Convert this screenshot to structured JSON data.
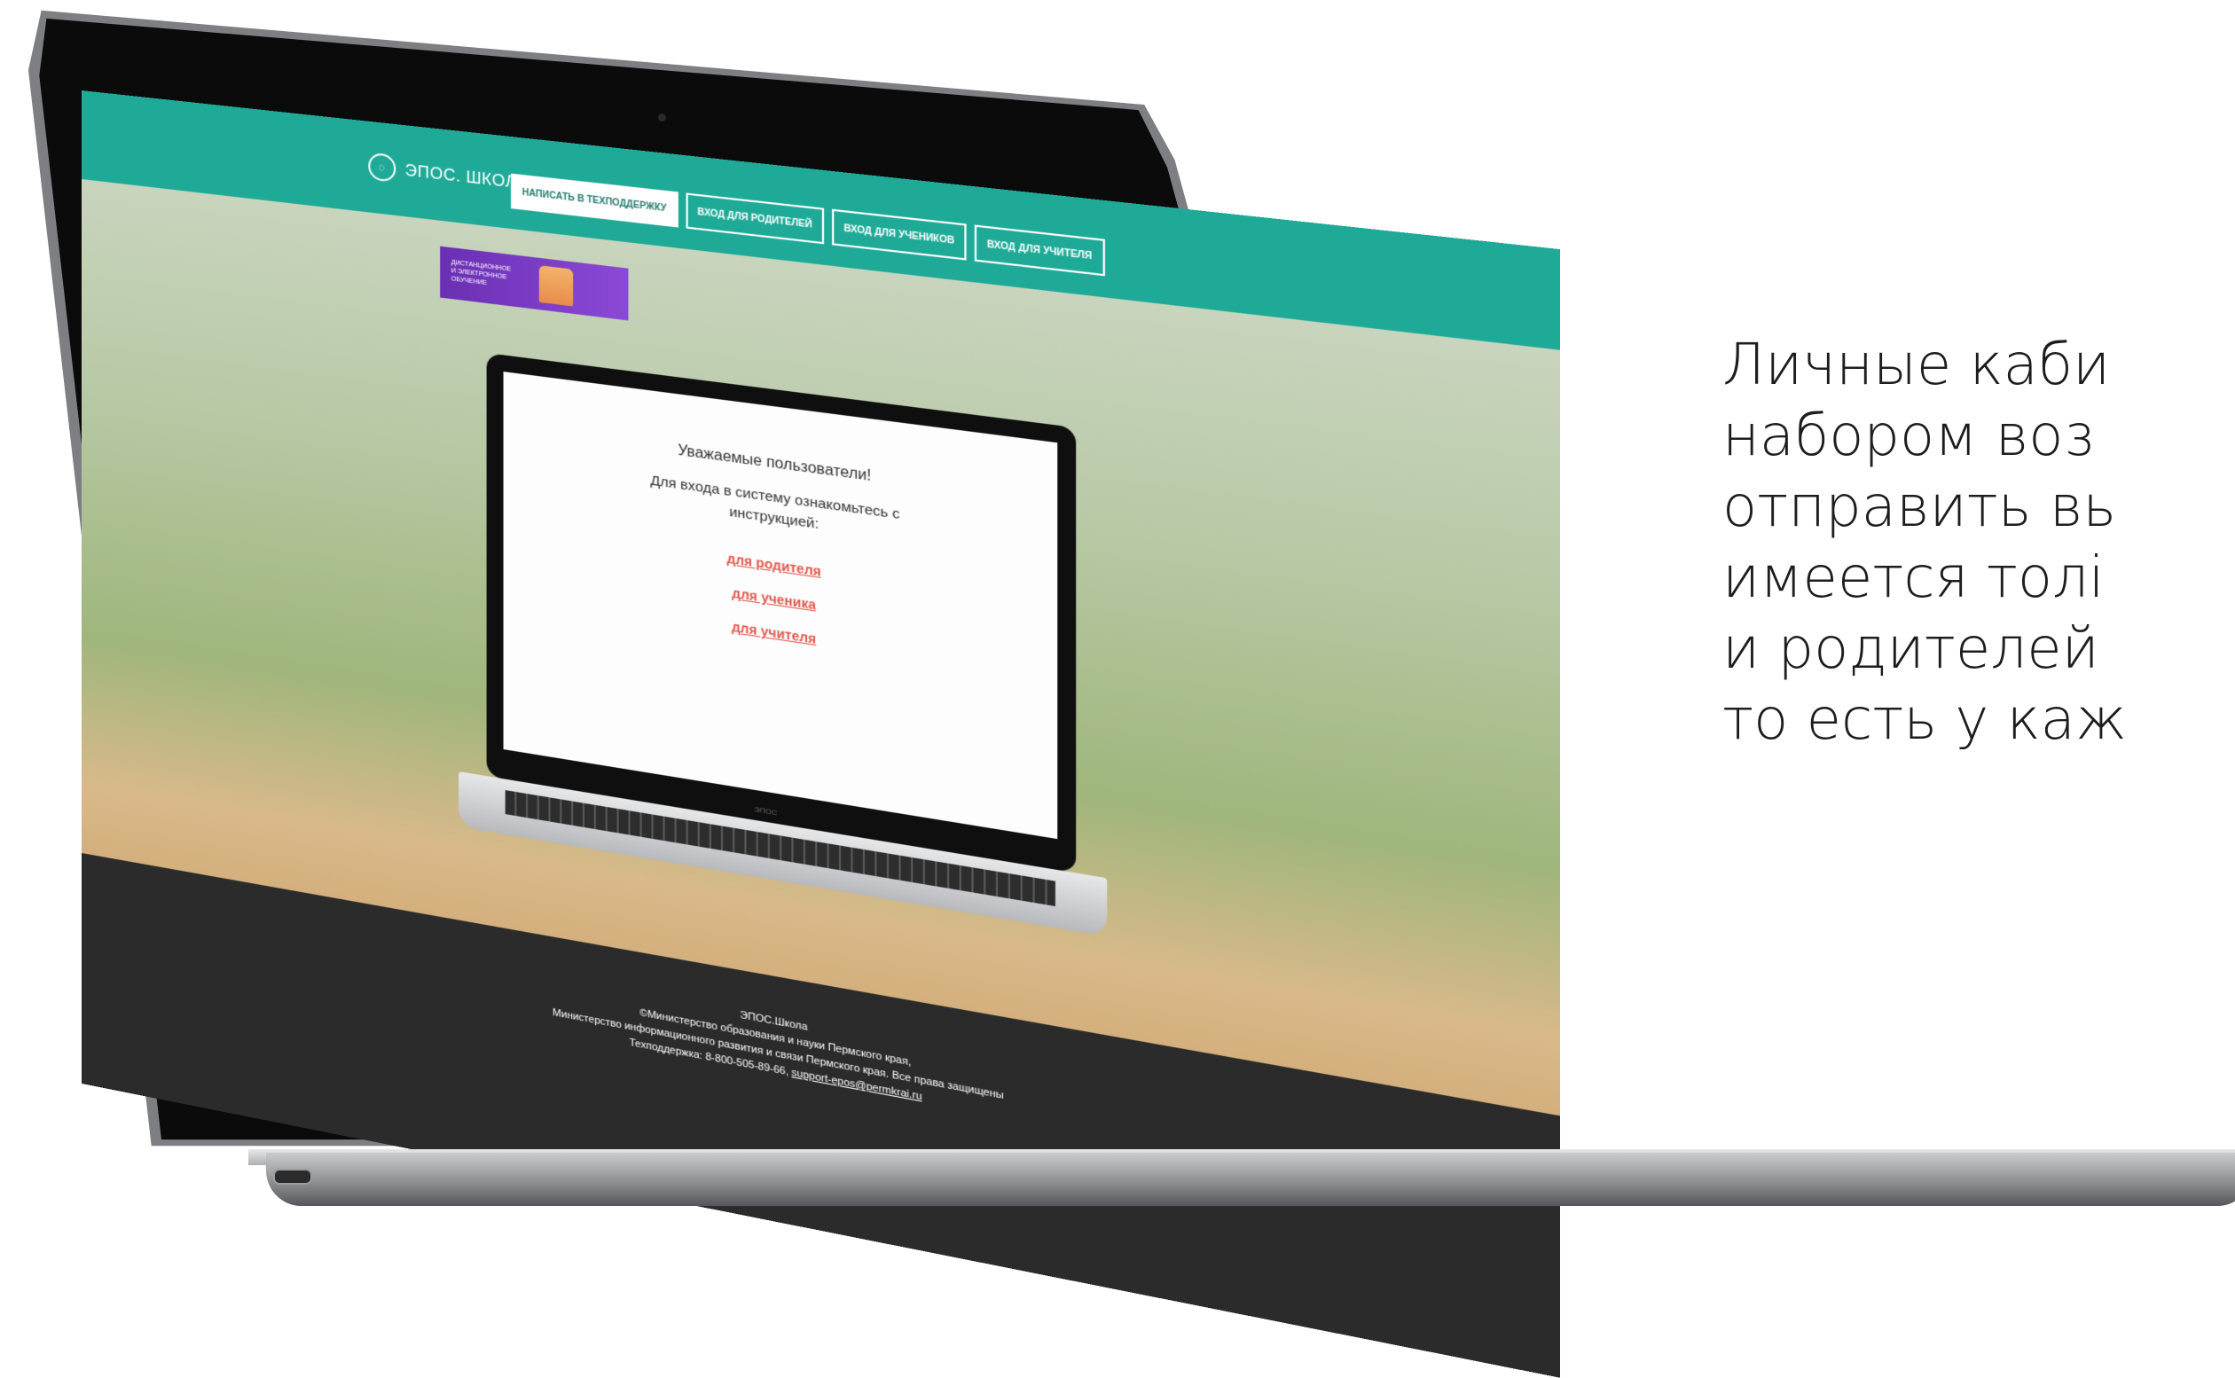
{
  "site": {
    "logo_text": "ЭПОС. ШКОЛА",
    "nav": [
      {
        "label": "НАПИСАТЬ В ТЕХПОДДЕРЖКУ"
      },
      {
        "label": "ВХОД ДЛЯ РОДИТЕЛЕЙ"
      },
      {
        "label": "ВХОД ДЛЯ УЧЕНИКОВ"
      },
      {
        "label": "ВХОД ДЛЯ УЧИТЕЛЯ"
      }
    ],
    "banner_text": "ДИСТАНЦИОННОЕ И ЭЛЕКТРОННОЕ ОБУЧЕНИЕ"
  },
  "notice": {
    "title": "Уважаемые пользователи!",
    "line1": "Для входа в систему ознакомьтесь с",
    "line2": "инструкцией:",
    "links": [
      "для родителя",
      "для ученика",
      "для учителя"
    ],
    "inner_logo": "ЭПОС"
  },
  "footer": {
    "line1": "ЭПОС.Школа",
    "line2": "©Министерство образования и науки Пермского края,",
    "line3": "Министерство информационного развития и связи Пермского края. Все права защищены",
    "line4_prefix": "Техподдержка: 8-800-505-89-66,",
    "line4_link": "support-epos@permkrai.ru"
  },
  "side_text": {
    "lines": [
      "Личные каби",
      "набором воз",
      "отправить вь",
      "имеется толі",
      "и родителей",
      "то есть у каж"
    ]
  },
  "colors": {
    "topbar": "#1faa97",
    "footer": "#2b2b2b",
    "link": "#e2574c",
    "banner": "#7a3cc8"
  }
}
